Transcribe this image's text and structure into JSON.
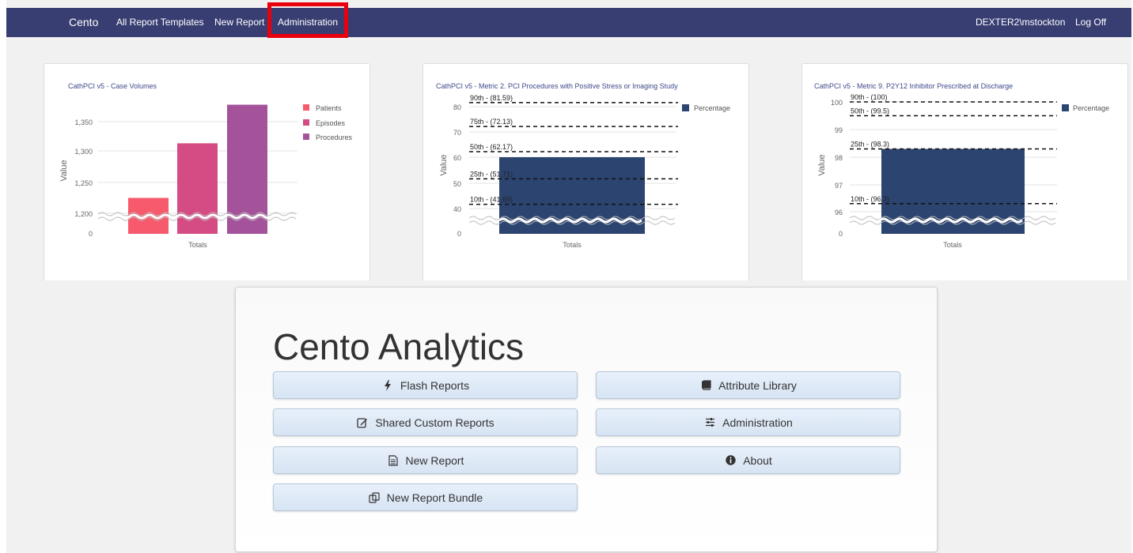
{
  "nav": {
    "brand": "Cento",
    "links": [
      "All Report Templates",
      "New Report",
      "Administration"
    ],
    "user": "DEXTER2\\mstockton",
    "logoff": "Log Off"
  },
  "charts": [
    {
      "title": "CathPCI v5 - Case Volumes",
      "ylabel": "Value",
      "xlabel": "Totals",
      "yticks": [
        "1,350",
        "1,300",
        "1,250",
        "1,200",
        "0"
      ],
      "legend": [
        "Patients",
        "Episodes",
        "Procedures"
      ]
    },
    {
      "title": "CathPCI v5 - Metric 2. PCI Procedures with Positive Stress or Imaging Study",
      "ylabel": "Value",
      "xlabel": "Totals",
      "yticks": [
        "80",
        "70",
        "60",
        "50",
        "40",
        "0"
      ],
      "legend": [
        "Percentage"
      ],
      "benchmarks": [
        "90th - (81.59)",
        "75th - (72.13)",
        "50th - (62.17)",
        "25th - (51.71)",
        "10th - (41.69)"
      ]
    },
    {
      "title": "CathPCI v5 - Metric 9. P2Y12 Inhibitor Prescribed at Discharge",
      "ylabel": "Value",
      "xlabel": "Totals",
      "yticks": [
        "100",
        "99",
        "98",
        "97",
        "96",
        "0"
      ],
      "legend": [
        "Percentage"
      ],
      "benchmarks": [
        "90th - (100)",
        "50th - (99.5)",
        "25th - (98.3)",
        "10th - (96.3)"
      ]
    }
  ],
  "chart_data": [
    {
      "type": "bar",
      "categories": [
        "Totals"
      ],
      "series": [
        {
          "name": "Patients",
          "values": [
            1225
          ],
          "color": "#f65a6c"
        },
        {
          "name": "Episodes",
          "values": [
            1313
          ],
          "color": "#d54c84"
        },
        {
          "name": "Procedures",
          "values": [
            1379
          ],
          "color": "#a4529a"
        }
      ],
      "ylim": [
        1180,
        1390
      ],
      "axis_break": true
    },
    {
      "type": "bar",
      "categories": [
        "Totals"
      ],
      "series": [
        {
          "name": "Percentage",
          "values": [
            60
          ],
          "color": "#2c4470"
        }
      ],
      "ylim": [
        35,
        83
      ],
      "axis_break": true,
      "benchmarks": [
        81.59,
        72.13,
        62.17,
        51.71,
        41.69
      ]
    },
    {
      "type": "bar",
      "categories": [
        "Totals"
      ],
      "series": [
        {
          "name": "Percentage",
          "values": [
            98.3
          ],
          "color": "#2c4470"
        }
      ],
      "ylim": [
        95.5,
        100.1
      ],
      "axis_break": true,
      "benchmarks": [
        100,
        99.5,
        98.3,
        96.3
      ]
    }
  ],
  "main": {
    "title": "Cento Analytics",
    "buttons_left": [
      "Flash Reports",
      "Shared Custom Reports",
      "New Report",
      "New Report Bundle"
    ],
    "buttons_right": [
      "Attribute Library",
      "Administration",
      "About"
    ],
    "icons_left": [
      "flash-icon",
      "edit-icon",
      "document-icon",
      "copy-icon"
    ],
    "icons_right": [
      "book-icon",
      "sliders-icon",
      "info-icon"
    ]
  }
}
